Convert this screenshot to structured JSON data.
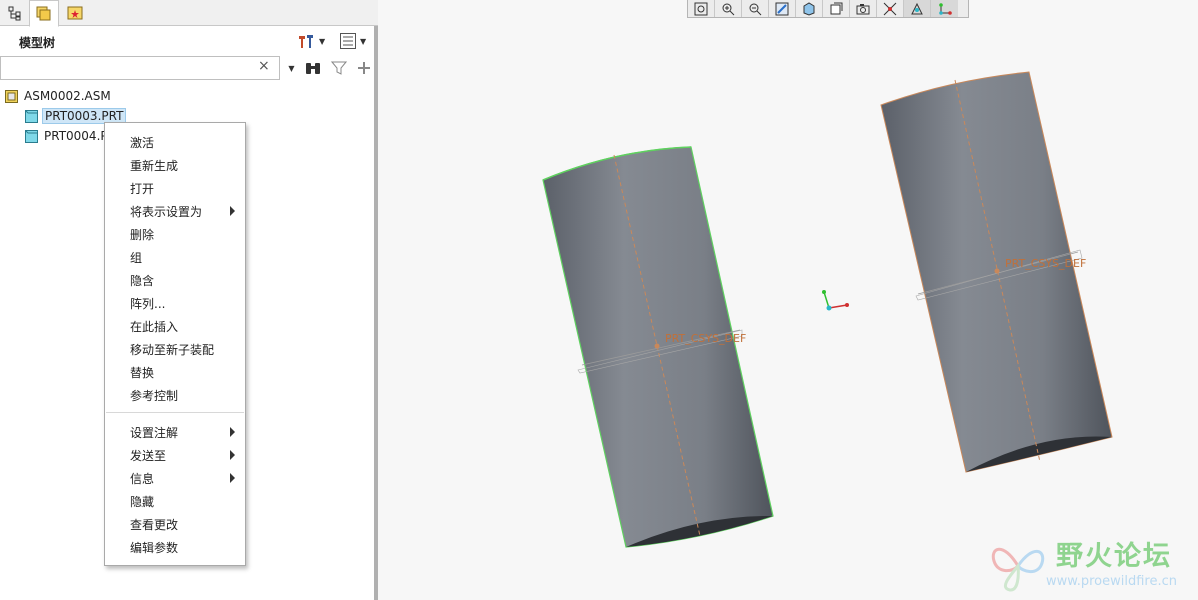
{
  "tree_panel": {
    "title": "模型树",
    "search_value": "",
    "clear_symbol": "×",
    "items": [
      {
        "label": "ASM0002.ASM"
      },
      {
        "label": "PRT0003.PRT"
      },
      {
        "label": "PRT0004.P"
      }
    ]
  },
  "context_menu": {
    "items": [
      {
        "label": "激活"
      },
      {
        "label": "重新生成"
      },
      {
        "label": "打开"
      },
      {
        "label": "将表示设置为"
      },
      {
        "label": "删除"
      },
      {
        "label": "组"
      },
      {
        "label": "隐含"
      },
      {
        "label": "阵列..."
      },
      {
        "label": "在此插入"
      },
      {
        "label": "移动至新子装配"
      },
      {
        "label": "替换"
      },
      {
        "label": "参考控制"
      },
      {
        "label": "设置注解"
      },
      {
        "label": "发送至"
      },
      {
        "label": "信息"
      },
      {
        "label": "隐藏"
      },
      {
        "label": "查看更改"
      },
      {
        "label": "编辑参数"
      }
    ]
  },
  "viewport": {
    "csys_label_1": "PRT_CSYS_DEF",
    "csys_label_2": "PRT_CSYS_DEF"
  },
  "watermark": {
    "title": "野火论坛",
    "url": "www.proewildfire.cn"
  },
  "colors": {
    "cylinder_body": "#7b8087",
    "cylinder_highlight": "#5fd15f",
    "cylinder_outline": "#c9885a",
    "selection_bg": "#cfe6f7"
  }
}
